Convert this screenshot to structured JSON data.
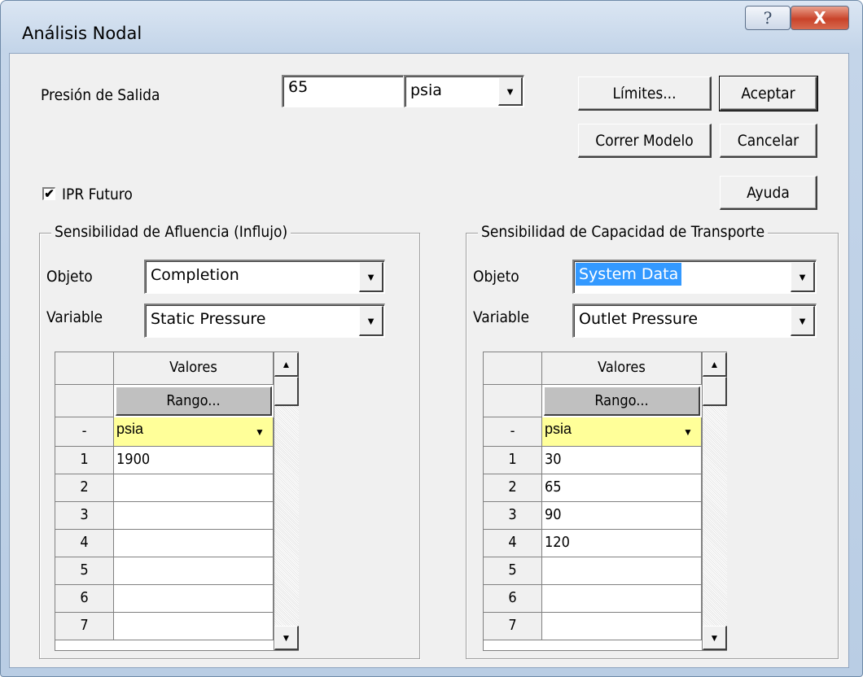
{
  "window": {
    "title": "Análisis Nodal",
    "help_glyph": "?",
    "close_glyph": "X"
  },
  "outlet": {
    "label": "Presión de Salida",
    "value": "65",
    "unit": "psia"
  },
  "buttons": {
    "limites": "Límites...",
    "aceptar": "Aceptar",
    "correr": "Correr Modelo",
    "cancelar": "Cancelar",
    "ayuda": "Ayuda"
  },
  "ipr": {
    "label": "IPR Futuro",
    "checked": true,
    "check_glyph": "✔"
  },
  "left": {
    "legend": "Sensibilidad de Afluencia (Influjo)",
    "objeto_label": "Objeto",
    "objeto_value": "Completion",
    "variable_label": "Variable",
    "variable_value": "Static Pressure",
    "table": {
      "header": "Valores",
      "range_button": "Rango...",
      "unit_row_label": "-",
      "unit": "psia",
      "rows": [
        {
          "n": "1",
          "v": "1900"
        },
        {
          "n": "2",
          "v": ""
        },
        {
          "n": "3",
          "v": ""
        },
        {
          "n": "4",
          "v": ""
        },
        {
          "n": "5",
          "v": ""
        },
        {
          "n": "6",
          "v": ""
        },
        {
          "n": "7",
          "v": ""
        }
      ]
    }
  },
  "right": {
    "legend": "Sensibilidad de Capacidad de Transporte",
    "objeto_label": "Objeto",
    "objeto_value": "System Data",
    "variable_label": "Variable",
    "variable_value": "Outlet Pressure",
    "table": {
      "header": "Valores",
      "range_button": "Rango...",
      "unit_row_label": "-",
      "unit": "psia",
      "rows": [
        {
          "n": "1",
          "v": "30"
        },
        {
          "n": "2",
          "v": "65"
        },
        {
          "n": "3",
          "v": "90"
        },
        {
          "n": "4",
          "v": "120"
        },
        {
          "n": "5",
          "v": ""
        },
        {
          "n": "6",
          "v": ""
        },
        {
          "n": "7",
          "v": ""
        }
      ]
    }
  },
  "glyphs": {
    "dropdown": "▼",
    "scroll_up": "▲",
    "scroll_down": "▼"
  },
  "colors": {
    "selection": "#3399ff",
    "unit_cell": "#ffff99",
    "close_button": "#c9432a"
  }
}
